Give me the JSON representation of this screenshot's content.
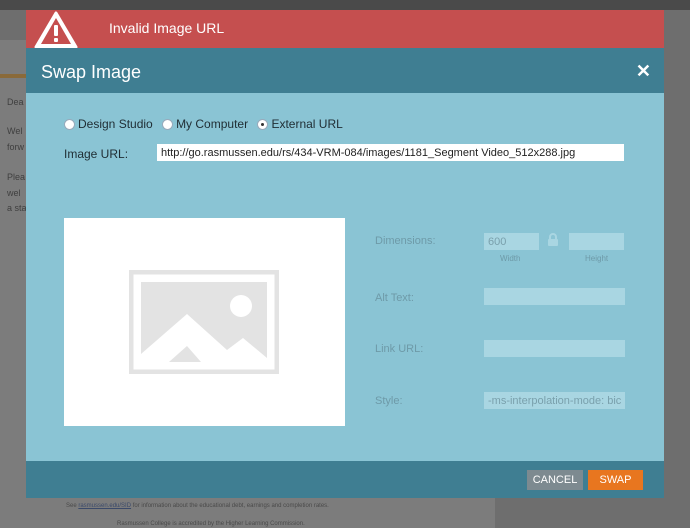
{
  "alert": {
    "icon": "warning-triangle-icon",
    "message": "Invalid Image URL"
  },
  "background": {
    "snippets": [
      "Dea",
      "Wel",
      "forw",
      "Plea",
      "wel",
      "a sta"
    ],
    "footer_line1_prefix": "See ",
    "footer_link": "rasmussen.edu/SID",
    "footer_line1_suffix": " for information about the educational debt, earnings and completion rates.",
    "footer_line2": "Rasmussen College is accredited by the Higher Learning Commission."
  },
  "modal": {
    "title": "Swap Image",
    "close_icon": "close-icon",
    "source_options": [
      {
        "label": "Design Studio",
        "selected": false
      },
      {
        "label": "My Computer",
        "selected": false
      },
      {
        "label": "External URL",
        "selected": true
      }
    ],
    "image_url_label": "Image URL:",
    "image_url_value": "http://go.rasmussen.edu/rs/434-VRM-084/images/1181_Segment Video_512x288.jpg",
    "preview_icon": "image-placeholder-icon",
    "dimensions_label": "Dimensions:",
    "width_value": "600",
    "width_caption": "Width",
    "height_value": "",
    "height_caption": "Height",
    "lock_icon": "lock-icon",
    "alt_text_label": "Alt Text:",
    "alt_text_value": "",
    "link_url_label": "Link URL:",
    "link_url_value": "",
    "style_label": "Style:",
    "style_value": "-ms-interpolation-mode: bic",
    "cancel_label": "CANCEL",
    "swap_label": "SWAP"
  },
  "colors": {
    "alert_bg": "#c54f4f",
    "header_bg": "#3f7e92",
    "modal_bg": "#8ac4d4",
    "swap_button": "#e8761f",
    "cancel_button": "#7d8a90"
  }
}
